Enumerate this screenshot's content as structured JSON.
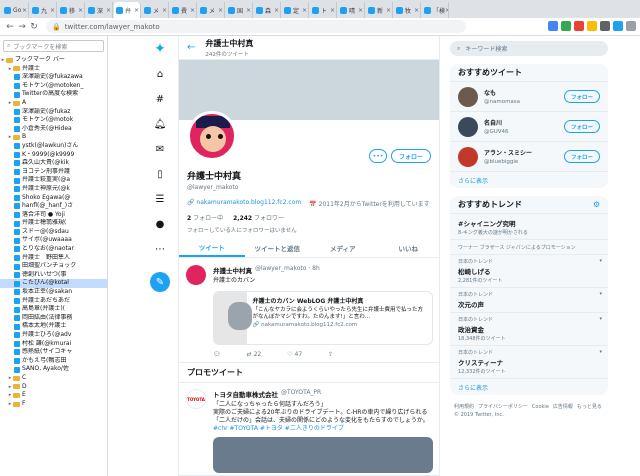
{
  "browser": {
    "tabs": [
      {
        "label": "Go"
      },
      {
        "label": "九"
      },
      {
        "label": "移"
      },
      {
        "label": "深"
      },
      {
        "label": "弁",
        "active": true
      },
      {
        "label": "メ"
      },
      {
        "label": "費"
      },
      {
        "label": "メ"
      },
      {
        "label": "国"
      },
      {
        "label": "森"
      },
      {
        "label": "定"
      },
      {
        "label": "ト"
      },
      {
        "label": "晴"
      },
      {
        "label": "新"
      },
      {
        "label": "牧"
      },
      {
        "label": "「検"
      }
    ],
    "url": "twitter.com/lawyer_makoto"
  },
  "bookmarks": {
    "search_placeholder": "ブックマークを検索",
    "rows": [
      {
        "label": "ブックマーク バー",
        "kind": "folder",
        "level": 0
      },
      {
        "label": "弁護士",
        "kind": "folder",
        "level": 1
      },
      {
        "label": "深澤諭史(@fukazawa",
        "kind": "tw",
        "level": 2
      },
      {
        "label": "モトケン(@motoken_",
        "kind": "tw",
        "level": 2
      },
      {
        "label": "Twitterの高度な検索",
        "kind": "tw",
        "level": 2
      },
      {
        "label": "A",
        "kind": "folder",
        "level": 1
      },
      {
        "label": "深澤諭史(@fukaz",
        "kind": "tw",
        "level": 2
      },
      {
        "label": "モトケン(@motok",
        "kind": "tw",
        "level": 2
      },
      {
        "label": "小倉秀夫(@Hidea",
        "kind": "tw",
        "level": 2
      },
      {
        "label": "B",
        "kind": "folder",
        "level": 1
      },
      {
        "label": "ystk(@lawkun)さん",
        "kind": "tw",
        "level": 2
      },
      {
        "label": "K・9999(@k9999",
        "kind": "tw",
        "level": 2
      },
      {
        "label": "森久山大貴(@kik",
        "kind": "tw",
        "level": 2
      },
      {
        "label": "ヨコテン刑事弁護",
        "kind": "tw",
        "level": 2
      },
      {
        "label": "弁護士萩重実(@a",
        "kind": "tw",
        "level": 2
      },
      {
        "label": "弁護士神原元(@k",
        "kind": "tw",
        "level": 2
      },
      {
        "label": "Shoko Egawa(@",
        "kind": "tw",
        "level": 2
      },
      {
        "label": "hanfl(@_hanf_)さ",
        "kind": "tw",
        "level": 2
      },
      {
        "label": "落合洋司 ● Yoji",
        "kind": "tw",
        "level": 2
      },
      {
        "label": "弁護士穂翡雅規(",
        "kind": "tw",
        "level": 2
      },
      {
        "label": "スドー@(@sdau",
        "kind": "tw",
        "level": 2
      },
      {
        "label": "サイボ(@uwaaaa",
        "kind": "tw",
        "level": 2
      },
      {
        "label": "とりなお(@naotar",
        "kind": "tw",
        "level": 2
      },
      {
        "label": "弁護士　野田隼人",
        "kind": "tw",
        "level": 2
      },
      {
        "label": "田畑聖パンチョック",
        "kind": "tw",
        "level": 2
      },
      {
        "label": "徳創れいせつ(事",
        "kind": "tw",
        "level": 2
      },
      {
        "label": "こたびん(@kotal",
        "kind": "tw",
        "level": 2,
        "selected": true
      },
      {
        "label": "坂本正幸(@sakan",
        "kind": "tw",
        "level": 2
      },
      {
        "label": "弁護士あだちあだ",
        "kind": "tw",
        "level": 2
      },
      {
        "label": "高島章(弁護士)(",
        "kind": "tw",
        "level": 2
      },
      {
        "label": "岡田紘由(法律事務",
        "kind": "tw",
        "level": 2
      },
      {
        "label": "橋本太地(弁護士",
        "kind": "tw",
        "level": 2
      },
      {
        "label": "弁護士ひろ(@adv",
        "kind": "tw",
        "level": 2
      },
      {
        "label": "村松 謙(@kmurai",
        "kind": "tw",
        "level": 2
      },
      {
        "label": "感熱紙(サイコキャ",
        "kind": "tw",
        "level": 2
      },
      {
        "label": "かもえ弓(鴨志田",
        "kind": "tw",
        "level": 2
      },
      {
        "label": "SANO, Ayako/佐",
        "kind": "tw",
        "level": 2
      },
      {
        "label": "C",
        "kind": "folder",
        "level": 1
      },
      {
        "label": "D",
        "kind": "folder",
        "level": 1
      },
      {
        "label": "E",
        "kind": "folder",
        "level": 1
      },
      {
        "label": "F",
        "kind": "folder",
        "level": 1
      }
    ]
  },
  "profile": {
    "header_name": "弁護士中村真",
    "header_count": "242件のツイート",
    "avatar_text": "中村",
    "name": "弁護士中村真",
    "handle": "@lawyer_makoto",
    "link": "nakamuramakoto.blog112.fc2.com",
    "joined": "2011年2月からTwitterを利用しています",
    "following_count": "2",
    "following_label": "フォロー中",
    "followers_count": "2,242",
    "followers_label": "フォロワー",
    "note": "フォローしている人にフォロワーはいません",
    "more_label": "•••",
    "follow_label": "フォロー"
  },
  "tabs": [
    "ツイート",
    "ツイートと返信",
    "メディア",
    "いいね"
  ],
  "tweet": {
    "name": "弁護士中村真",
    "handle": "@lawyer_makoto · 8h",
    "text": "弁護士のカバン",
    "card_title": "弁護士のカバン WebLOG 弁護士中村真",
    "card_desc": "「こんなヤカラに会ようくらいやったら先生に弁護士費用で払った方がなんぼかマシですわ。たのんます!」と言わ…",
    "card_url": "nakamuramakoto.blog112.fc2.com",
    "replies": "22",
    "likes": "47"
  },
  "promo": {
    "heading": "プロモツイート",
    "avatar": "TOYOTA",
    "name": "トヨタ自動車株式会社",
    "handle": "@TOYOTA_PR",
    "line1": "「二人になっちゃったら何話すんだろう」",
    "line2": "実際のご夫婦による20年ぶりのドライブデート。C-HRの車内で繰り広げられる「二人だけの」会話は、夫婦の関係にどのような変化をもたらすのでしょうか。",
    "tags": "#chr #TOYOTA #トヨタ #二人きりのドライブ"
  },
  "right": {
    "search_placeholder": "キーワード検索",
    "recommend_title": "おすすめツイート",
    "recommend": [
      {
        "name": "なも",
        "handle": "@namomasa",
        "btn": "フォロー",
        "color": "#6b5a4e"
      },
      {
        "name": "名自川",
        "handle": "@GUV46",
        "btn": "フォロー",
        "color": "#3a4a5a"
      },
      {
        "name": "アラン・スミシー",
        "handle": "@bluebiggie",
        "btn": "フォロー",
        "color": "#c0392b"
      }
    ],
    "more_label": "さらに表示",
    "trends_title": "おすすめトレンド",
    "trends": [
      {
        "category": "",
        "name": "#シャイニング究明",
        "desc": "8-キング義大の謎が明かされる"
      },
      {
        "category": "",
        "name": "",
        "desc": "ワーナー ブラザース ジャパンによるプロモーション"
      },
      {
        "category": "日本のトレンド",
        "name": "松崎しげる",
        "desc": "2,281件のツイート"
      },
      {
        "category": "日本のトレンド",
        "name": "次元の声",
        "desc": ""
      },
      {
        "category": "日本のトレンド",
        "name": "政治資金",
        "desc": "18,348件のツイート"
      },
      {
        "category": "日本のトレンド",
        "name": "クリスティーナ",
        "desc": "12,332件のツイート"
      }
    ],
    "trends_more": "さらに表示",
    "footer": [
      "利用規約",
      "プライバシーポリシー",
      "Cookie",
      "広告情報",
      "もっと見る",
      "© 2019 Twitter, Inc."
    ]
  }
}
